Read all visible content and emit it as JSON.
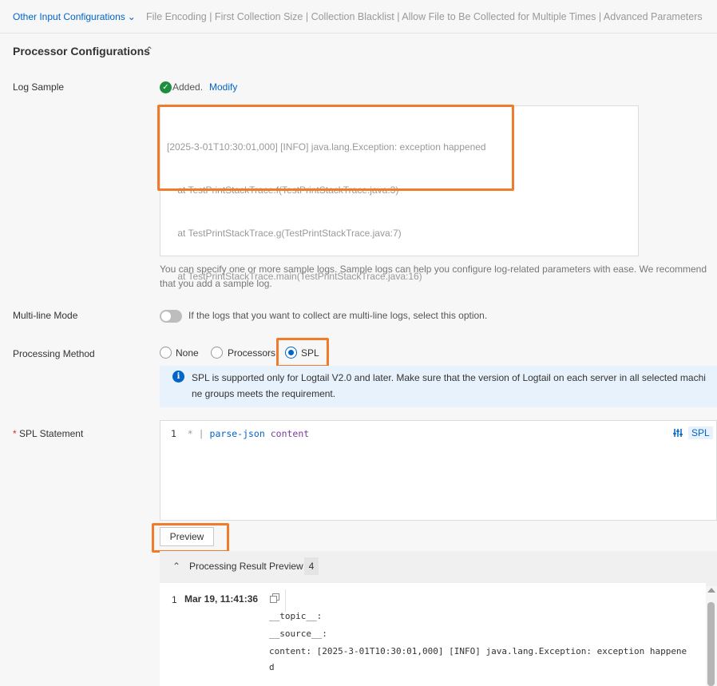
{
  "top": {
    "other_link": "Other Input Configurations",
    "other_items": "File Encoding | First Collection Size | Collection Blacklist | Allow File to Be Collected for Multiple Times | Advanced Parameters"
  },
  "section": {
    "title": "Processor Configurations"
  },
  "log_sample": {
    "label": "Log Sample",
    "added": "Added.",
    "modify": "Modify",
    "lines": [
      "[2025-3-01T10:30:01,000] [INFO] java.lang.Exception: exception happened",
      "    at TestPrintStackTrace.f(TestPrintStackTrace.java:3)",
      "    at TestPrintStackTrace.g(TestPrintStackTrace.java:7)",
      "    at TestPrintStackTrace.main(TestPrintStackTrace.java:16)"
    ],
    "help_line1": "You can specify one or more sample logs. Sample logs can help you configure log-related parameters with ease. We recommend",
    "help_line2": "that you add a sample log."
  },
  "multiline": {
    "label": "Multi-line Mode",
    "enabled": false,
    "description": "If the logs that you want to collect are multi-line logs, select this option."
  },
  "processing": {
    "label": "Processing Method",
    "options": [
      "None",
      "Processors",
      "SPL"
    ],
    "selected": "SPL",
    "info_line1": "SPL is supported only for Logtail V2.0 and later. Make sure that the version of Logtail on each server in all selected machi",
    "info_line2": "ne groups meets the requirement."
  },
  "spl": {
    "required_mark": "*",
    "label": "SPL Statement",
    "line_number": "1",
    "star": "*",
    "pipe": "|",
    "command": "parse-json",
    "argument": "content",
    "badge": "SPL"
  },
  "preview": {
    "button": "Preview",
    "header": "Processing Result Preview",
    "count": "4",
    "result_index": "1",
    "result_time": "Mar 19, 11:41:36",
    "fields": [
      "__topic__:",
      "__source__:",
      "content: [2025-3-01T10:30:01,000] [INFO] java.lang.Exception: exception happene",
      "d"
    ]
  },
  "colors": {
    "accent": "#0064c8",
    "highlight": "#f07c2b",
    "success": "#1e8e3e"
  }
}
